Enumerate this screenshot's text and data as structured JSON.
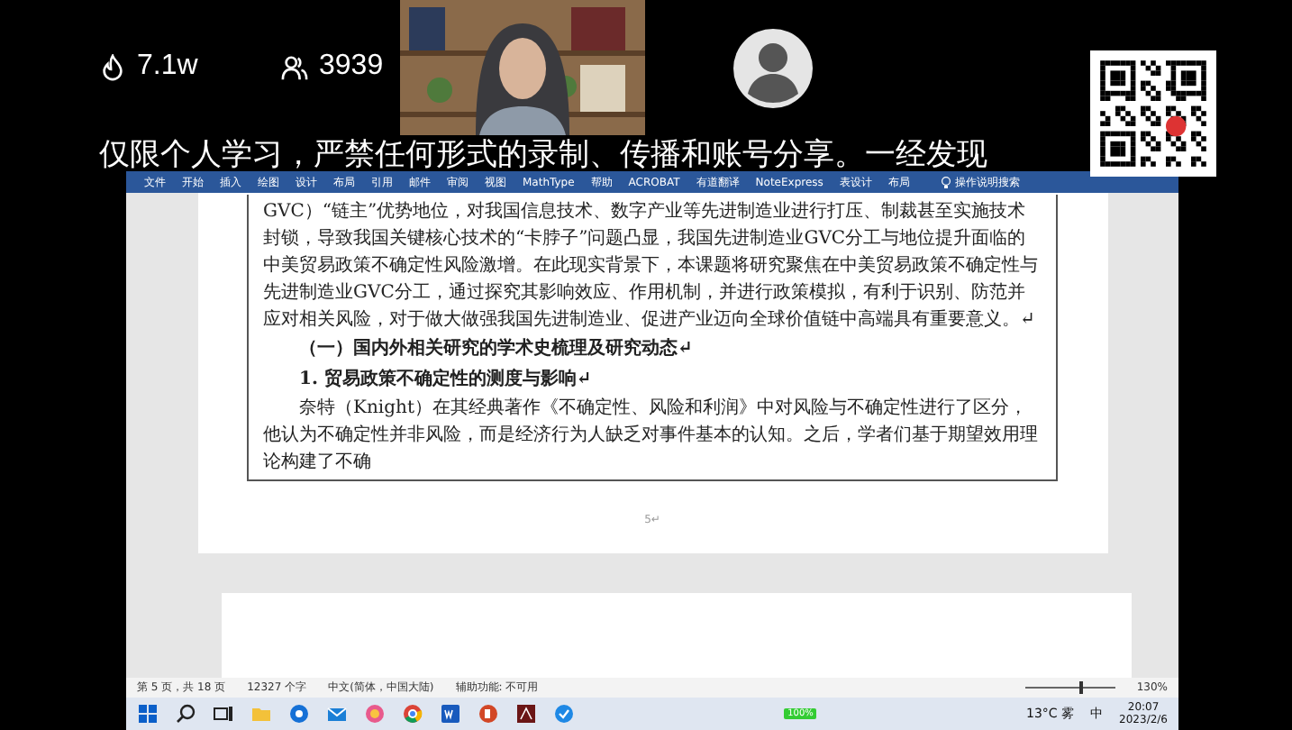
{
  "stats": {
    "heat": "7.1w",
    "viewers": "3939"
  },
  "banner": "仅限个人学习，严禁任何形式的录制、传播和账号分享。一经发现",
  "ribbon": {
    "tabs": [
      "文件",
      "开始",
      "插入",
      "绘图",
      "设计",
      "布局",
      "引用",
      "邮件",
      "审阅",
      "视图",
      "MathType",
      "帮助",
      "ACROBAT",
      "有道翻译",
      "NoteExpress",
      "表设计",
      "布局"
    ],
    "search": "操作说明搜索"
  },
  "document": {
    "lines": [
      "GVC）“链主”优势地位，对我国信息技术、数字产业等先进制造业进行打压、制裁甚至实施技术封锁，导致我国关键核心技术的“卡脖子”问题凸显，我国先进制造业GVC分工与地位提升面临的中美贸易政策不确定性风险激增。在此现实背景下，本课题将研究聚焦在中美贸易政策不确定性与先进制造业GVC分工，通过探究其影响效应、作用机制，并进行政策模拟，有利于识别、防范并应对相关风险，对于做大做强我国先进制造业、促进产业迈向全球价值链中高端具有重要意义。↵"
    ],
    "heading": "（一）国内外相关研究的学术史梳理及研究动态↵",
    "subheading": "1. 贸易政策不确定性的测度与影响↵",
    "paragraph": "奈特（Knight）在其经典著作《不确定性、风险和利润》中对风险与不确定性进行了区分，他认为不确定性并非风险，而是经济行为人缺乏对事件基本的认知。之后，学者们基于期望效用理论构建了不确",
    "page_number": "5↵"
  },
  "status_bar": {
    "page": "第 5 页，共 18 页",
    "words": "12327 个字",
    "language": "中文(简体，中国大陆)",
    "accessibility": "辅助功能: 不可用",
    "zoom": "130%",
    "level": 0.6
  },
  "taskbar": {
    "battery": "100%",
    "weather": "13°C 雾",
    "ime": "中",
    "time": "20:07",
    "date": "2023/2/6"
  }
}
